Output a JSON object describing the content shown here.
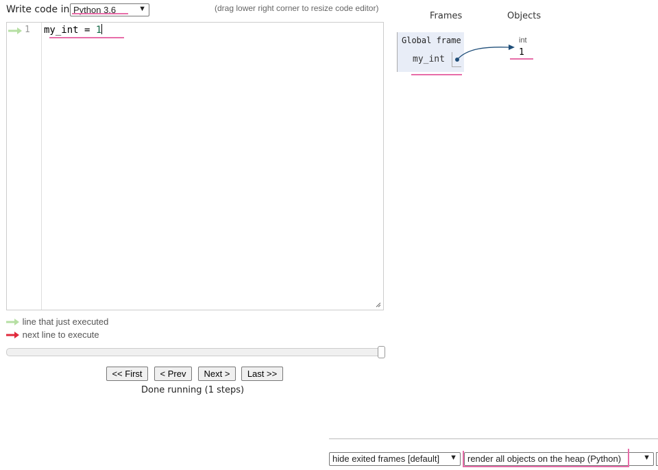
{
  "editor_header": {
    "write_label": "Write code in",
    "language": "Python 3.6",
    "hint": "(drag lower right corner to resize code editor)"
  },
  "editor": {
    "lines": [
      {
        "number": "1",
        "code": "my_int = ",
        "literal": "1"
      }
    ]
  },
  "legend": {
    "just_executed": "line that just executed",
    "next_line": "next line to execute",
    "green_color": "#b6dfa3",
    "red_color": "#e0293b"
  },
  "navigation": {
    "first": "<< First",
    "prev": "< Prev",
    "next": "Next >",
    "last": "Last >>",
    "status": "Done running (1 steps)",
    "progress": 1.0
  },
  "visualization": {
    "frames_header": "Frames",
    "objects_header": "Objects",
    "global_frame_title": "Global frame",
    "variable_name": "my_int",
    "object_type": "int",
    "object_value": "1",
    "frame_bg": "#e8edf7",
    "arrow_color": "#1f4e79"
  },
  "options": {
    "frames_option": "hide exited frames [default]",
    "heap_option": "render all objects on the heap (Python)"
  },
  "annotation_color": "#e76ca8"
}
